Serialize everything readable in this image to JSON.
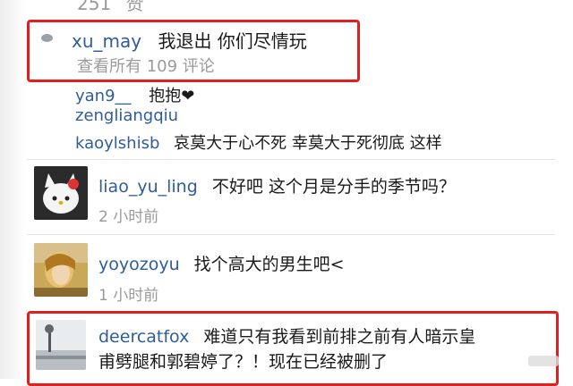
{
  "top_partial": {
    "count": "251",
    "label": "赞"
  },
  "comment_main": {
    "username": "xu_may",
    "text": "我退出 你们尽情玩",
    "view_all": "查看所有 109 评论"
  },
  "replies": [
    {
      "username": "yan9__",
      "text": "抱抱❤"
    },
    {
      "username": "zengliangqiu",
      "text": ""
    },
    {
      "username": "kaoylshisb",
      "text": "哀莫大于心不死 幸莫大于死彻底 这样"
    }
  ],
  "comments": [
    {
      "username": "liao_yu_ling",
      "text": "不好吧 这个月是分手的季节吗？",
      "time": "2 小时前"
    },
    {
      "username": "yoyozoyu",
      "text": "找个高大的男生吧<",
      "time": "1 小时前"
    },
    {
      "username": "deercatfox",
      "text_line1": "难道只有我看到前排之前有人暗示皇",
      "text_line2": "甫劈腿和郭碧婷了？！现在已经被删了"
    }
  ],
  "colors": {
    "username": "#2f5d99",
    "highlight": "#e02020",
    "meta": "#9a9a9a"
  }
}
